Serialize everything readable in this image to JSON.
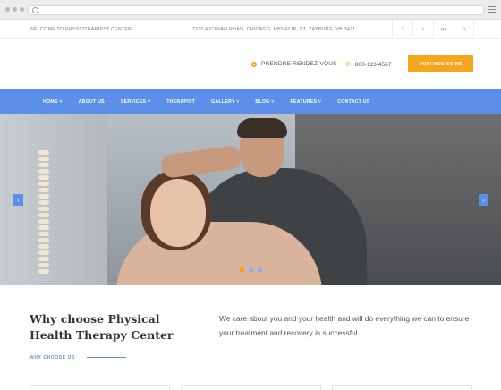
{
  "topbar": {
    "welcome": "WELCOME TO PHYSIOTHARIPST CENTER",
    "address": "7320 RICKVAN ROAD, CHICAGO, M83 42JR, ST. ZAYBURG, VB 3421",
    "social": [
      "f",
      "t",
      "g+",
      "p"
    ]
  },
  "header": {
    "appointment_label": "PRENDRE RENDEZ-VOUS",
    "phone": "800-123-4567",
    "cta_label": "VOIR NOS SOINS"
  },
  "nav": {
    "items": [
      "HOME ˅",
      "ABOUT US",
      "SERVICES ˅",
      "THERAPIST",
      "GALLERY ˅",
      "BLOG ˅",
      "FEATURES ˅",
      "CONTACT US"
    ]
  },
  "slider": {
    "prev": "‹",
    "next": "›",
    "active_slide": 1,
    "slide_count": 3
  },
  "intro": {
    "title": "Why choose Physical Health Therapy Center",
    "subtitle": "WHY CHOOSE US",
    "text": "We care about you and your health and will do everything we can to ensure your treatment and recovery is successful."
  },
  "colors": {
    "accent_blue": "#5b8fe8",
    "accent_orange": "#f7a51c"
  }
}
